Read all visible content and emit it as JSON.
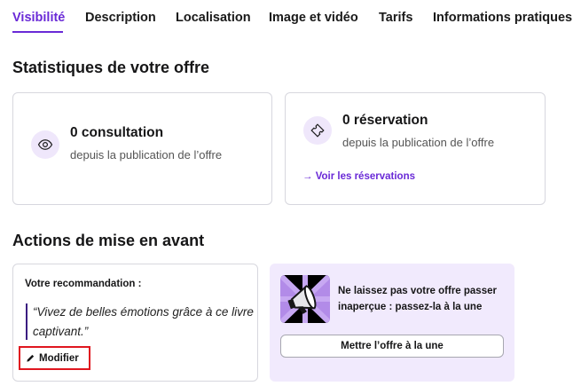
{
  "tabs": [
    {
      "label": "Visibilité",
      "active": true
    },
    {
      "label": "Description"
    },
    {
      "label": "Localisation"
    },
    {
      "label": "Image et vidéo"
    },
    {
      "label": "Tarifs"
    },
    {
      "label": "Informations pratiques"
    }
  ],
  "stats": {
    "title": "Statistiques de votre offre",
    "views": {
      "count_label": "0 consultation",
      "sub": "depuis la publication de l’offre",
      "icon": "eye-icon"
    },
    "bookings": {
      "count_label": "0 réservation",
      "sub": "depuis la publication de l’offre",
      "icon": "ticket-icon",
      "link": "→ Voir les réservations"
    }
  },
  "highlight": {
    "title": "Actions de mise en avant",
    "recommendation_label": "Votre recommandation :",
    "recommendation_quote": "“Vivez de belles émotions grâce à ce livre captivant.”",
    "modify_label": "Modifier",
    "promo_text": "Ne laissez pas votre offre passer inaperçue : passez-la à la une",
    "promo_button": "Mettre l’offre à la une"
  },
  "colors": {
    "accent": "#6a2ad7",
    "promo_bg": "#f1eafd",
    "highlight_border": "#e0161f"
  }
}
